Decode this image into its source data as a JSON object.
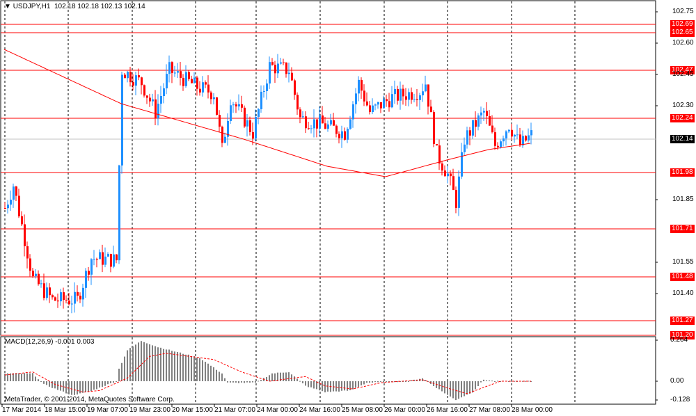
{
  "header": {
    "symbol": "USDJPY,H1",
    "open": "102.18",
    "high": "102.18",
    "low": "102.13",
    "close": "102.14"
  },
  "macd_label": "MACD(12,26,9) -0.001 0.003",
  "copyright": "MetaTrader, © 2001-2014, MetaQuotes Software Corp.",
  "colors": {
    "bull": "#1e90ff",
    "bear": "#ff0000",
    "level": "#ff0000",
    "ma": "#ff0000",
    "hist": "#808080",
    "signal": "#ff0000"
  },
  "chart_data": {
    "type": "candlestick",
    "title": "USDJPY,H1",
    "ylim": [
      101.2,
      102.79
    ],
    "y_ticks": [
      "102.75",
      "102.60",
      "102.45",
      "102.30",
      "101.85",
      "101.55",
      "101.40"
    ],
    "x_ticks": [
      "17 Mar 2014",
      "18 Mar 15:00",
      "19 Mar 07:00",
      "19 Mar 23:00",
      "20 Mar 15:00",
      "21 Mar 07:00",
      "24 Mar 00:00",
      "24 Mar 16:00",
      "25 Mar 08:00",
      "26 Mar 00:00",
      "26 Mar 16:00",
      "27 Mar 08:00",
      "28 Mar 00:00"
    ],
    "levels": [
      "102.69",
      "102.65",
      "102.47",
      "102.24",
      "101.98",
      "101.71",
      "101.48",
      "101.27",
      "101.20"
    ],
    "current_price": "102.14",
    "price_path": [
      [
        0,
        101.81
      ],
      [
        3,
        101.92
      ],
      [
        10,
        101.47
      ],
      [
        17,
        101.37
      ],
      [
        26,
        101.37
      ],
      [
        31,
        101.57
      ],
      [
        40,
        101.56
      ],
      [
        42,
        102.47
      ],
      [
        49,
        102.41
      ],
      [
        54,
        102.27
      ],
      [
        59,
        102.47
      ],
      [
        69,
        102.39
      ],
      [
        75,
        102.36
      ],
      [
        78,
        102.09
      ],
      [
        81,
        102.34
      ],
      [
        89,
        102.17
      ],
      [
        95,
        102.49
      ],
      [
        102,
        102.47
      ],
      [
        106,
        102.24
      ],
      [
        114,
        102.21
      ],
      [
        122,
        102.17
      ],
      [
        127,
        102.41
      ],
      [
        131,
        102.27
      ],
      [
        139,
        102.34
      ],
      [
        149,
        102.37
      ],
      [
        151,
        102.41
      ],
      [
        155,
        102.07
      ],
      [
        159,
        101.97
      ],
      [
        162,
        101.84
      ],
      [
        165,
        102.14
      ],
      [
        172,
        102.27
      ],
      [
        176,
        102.11
      ],
      [
        181,
        102.21
      ],
      [
        185,
        102.11
      ],
      [
        189,
        102.16
      ]
    ],
    "moving_average": [
      [
        0,
        102.57
      ],
      [
        42,
        102.31
      ],
      [
        86,
        102.14
      ],
      [
        116,
        102.01
      ],
      [
        137,
        101.96
      ],
      [
        159,
        102.04
      ],
      [
        174,
        102.09
      ],
      [
        189,
        102.12
      ]
    ],
    "macd": {
      "ylim": [
        -0.128,
        0.264
      ],
      "y_ticks": [
        "0.264",
        "0.00",
        "-0.128"
      ],
      "histogram": [
        [
          0,
          0.05
        ],
        [
          10,
          0.05
        ],
        [
          14,
          -0.02
        ],
        [
          24,
          -0.09
        ],
        [
          30,
          -0.07
        ],
        [
          40,
          0.0
        ],
        [
          41,
          0.08
        ],
        [
          44,
          0.2
        ],
        [
          49,
          0.26
        ],
        [
          55,
          0.22
        ],
        [
          70,
          0.15
        ],
        [
          78,
          0.05
        ],
        [
          80,
          -0.01
        ],
        [
          90,
          -0.01
        ],
        [
          96,
          0.05
        ],
        [
          102,
          0.06
        ],
        [
          108,
          -0.03
        ],
        [
          115,
          -0.07
        ],
        [
          124,
          -0.06
        ],
        [
          130,
          -0.01
        ],
        [
          145,
          0.0
        ],
        [
          150,
          0.02
        ],
        [
          154,
          -0.03
        ],
        [
          160,
          -0.1
        ],
        [
          162,
          -0.12
        ],
        [
          168,
          -0.07
        ],
        [
          172,
          0.01
        ],
        [
          176,
          0.0
        ],
        [
          189,
          0.0
        ]
      ],
      "signal": [
        [
          0,
          0.04
        ],
        [
          10,
          0.06
        ],
        [
          18,
          -0.02
        ],
        [
          28,
          -0.07
        ],
        [
          34,
          -0.06
        ],
        [
          44,
          0.02
        ],
        [
          52,
          0.16
        ],
        [
          58,
          0.18
        ],
        [
          75,
          0.14
        ],
        [
          85,
          0.06
        ],
        [
          95,
          0.0
        ],
        [
          108,
          0.03
        ],
        [
          115,
          -0.03
        ],
        [
          125,
          -0.05
        ],
        [
          135,
          -0.01
        ],
        [
          150,
          0.01
        ],
        [
          160,
          -0.05
        ],
        [
          166,
          -0.08
        ],
        [
          172,
          -0.04
        ],
        [
          178,
          0.0
        ],
        [
          189,
          0.0
        ]
      ]
    }
  }
}
